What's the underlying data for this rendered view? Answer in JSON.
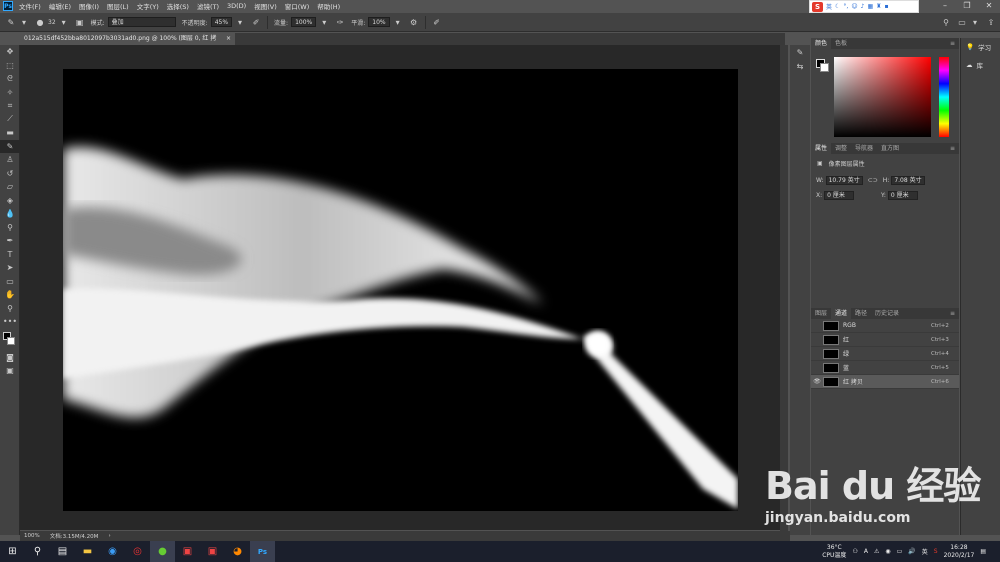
{
  "menubar": {
    "items": [
      "文件(F)",
      "编辑(E)",
      "图像(I)",
      "图层(L)",
      "文字(Y)",
      "选择(S)",
      "滤镜(T)",
      "3D(D)",
      "视图(V)",
      "窗口(W)",
      "帮助(H)"
    ]
  },
  "ime": {
    "label": "英",
    "icons": [
      "moon-icon",
      "punct-icon",
      "emoji-icon",
      "mic-icon",
      "keyboard-icon",
      "shirt-icon",
      "grid-icon"
    ]
  },
  "options": {
    "brush_size": "32",
    "mode_label": "模式:",
    "mode_value": "叠加",
    "opacity_label": "不透明度:",
    "opacity_value": "45%",
    "flow_label": "流量:",
    "flow_value": "100%",
    "smooth_label": "平滑:",
    "smooth_value": "10%"
  },
  "document_tab": {
    "title": "012a515df452bba8012097b3031ad0.png @ 100% (图层 0, 红 拷贝/8) *",
    "close": "×"
  },
  "status": {
    "zoom": "100%",
    "doc": "文档:3.15M/4.20M"
  },
  "color_panel": {
    "tabs": [
      "颜色",
      "色板"
    ],
    "fg": "#000000",
    "bg": "#ffffff"
  },
  "props_panel": {
    "tabs": [
      "属性",
      "调整",
      "导航器",
      "直方图"
    ],
    "heading": "像素图层属性",
    "w_label": "W:",
    "w_value": "10.79 英寸",
    "h_label": "H:",
    "h_value": "7.08 英寸",
    "x_label": "X:",
    "x_value": "0 厘米",
    "y_label": "Y:",
    "y_value": "0 厘米"
  },
  "channels_panel": {
    "tabs": [
      "图层",
      "通道",
      "路径",
      "历史记录"
    ],
    "rows": [
      {
        "name": "RGB",
        "key": "Ctrl+2"
      },
      {
        "name": "红",
        "key": "Ctrl+3"
      },
      {
        "name": "绿",
        "key": "Ctrl+4"
      },
      {
        "name": "蓝",
        "key": "Ctrl+5"
      },
      {
        "name": "红 拷贝",
        "key": "Ctrl+6"
      }
    ]
  },
  "right_dock": {
    "learn": "学习",
    "library": "库"
  },
  "tray": {
    "temp": "36°C",
    "cpu": "CPU温度",
    "time": "16:28",
    "date": "2020/2/17"
  },
  "watermark": {
    "logo": "Bai du 经验",
    "url": "jingyan.baidu.com"
  }
}
